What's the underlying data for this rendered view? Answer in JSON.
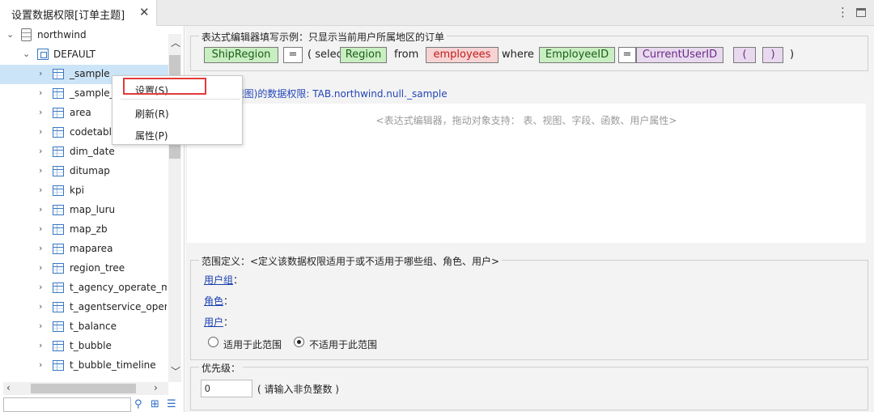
{
  "tab": {
    "title": "设置数据权限[订单主题]",
    "close_glyph": "✕"
  },
  "window_controls": {
    "menu_glyph": "⋮"
  },
  "tree": {
    "root": "northwind",
    "schema": "DEFAULT",
    "items": [
      "_sample",
      "_sample_",
      "area",
      "codetabl",
      "dim_date",
      "ditumap",
      "kpi",
      "map_luru",
      "map_zb",
      "maparea",
      "region_tree",
      "t_agency_operate_mo",
      "t_agentservice_opera",
      "t_balance",
      "t_bubble",
      "t_bubble_timeline"
    ],
    "selected": "_sample"
  },
  "context_menu": {
    "items": [
      "设置(S)",
      "刷新(R)",
      "属性(P)"
    ],
    "highlight_color": "#e33b3b"
  },
  "expression_example": {
    "legend": "表达式编辑器填写示例：只显示当前用户所属地区的订单",
    "tokens": {
      "field1": "ShipRegion",
      "eq1": "=",
      "paren_select": "( select",
      "field2": "Region",
      "from": "from",
      "table": "employees",
      "where": "where",
      "field3": "EmployeeID",
      "eq2": "=",
      "user_attr": "CurrentUserID",
      "open_paren": "(",
      "close_paren": ")",
      "end_paren": ")"
    }
  },
  "permission": {
    "title_prefix": "表(视图)的数据权限: ",
    "title_value": "TAB.northwind.null._sample",
    "editor_placeholder": "<表达式编辑器，拖动对象支持： 表、视图、字段、函数、用户属性>"
  },
  "scope": {
    "legend": "范围定义：<定义该数据权限适用于或不适用于哪些组、角色、用户>",
    "user_group": "用户组",
    "role": "角色",
    "user": "用户",
    "colon": "：",
    "apply_label": "适用于此范围",
    "not_apply_label": "不适用于此范围",
    "selected": "not_apply"
  },
  "priority": {
    "legend": "优先级：",
    "value": "0",
    "hint": "( 请输入非负整数 )"
  },
  "colors": {
    "green_chip": "#c9eec2",
    "red_chip": "#f7d3d3",
    "purple_chip": "#e8d9ef",
    "link": "#1a3fb0",
    "selection": "#cce4f7"
  }
}
